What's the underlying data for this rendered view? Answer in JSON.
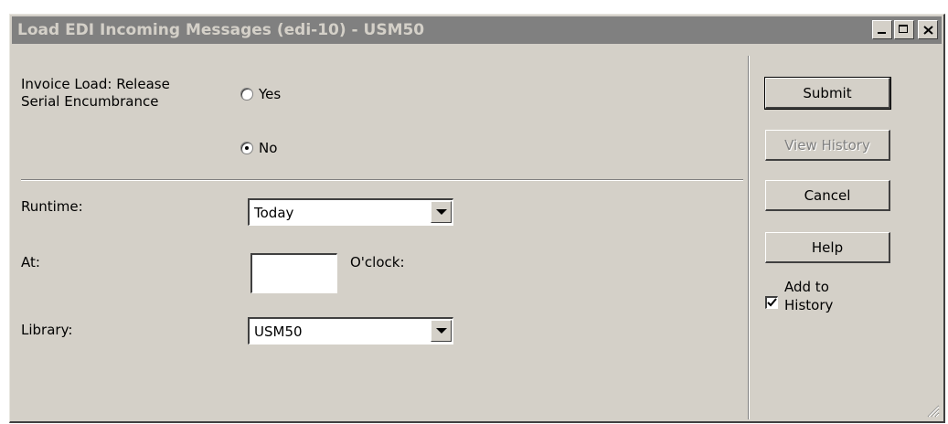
{
  "window": {
    "title": "Load EDI Incoming Messages (edi-10) - USM50"
  },
  "form": {
    "invoice_label_line1": "Invoice Load: Release",
    "invoice_label_line2": "Serial Encumbrance",
    "radio_yes": "Yes",
    "radio_no": "No",
    "selected": "No",
    "runtime_label": "Runtime:",
    "runtime_value": "Today",
    "at_label": "At:",
    "at_value": "",
    "oclock_label": "O'clock:",
    "library_label": "Library:",
    "library_value": "USM50"
  },
  "buttons": {
    "submit": "Submit",
    "view_history": "View History",
    "cancel": "Cancel",
    "help": "Help"
  },
  "add_to_history": {
    "line1": "Add to",
    "line2": "History",
    "checked": true
  },
  "icons": {
    "minimize": "minimize-icon",
    "maximize": "maximize-icon",
    "close": "close-icon",
    "dropdown": "chevron-down-icon",
    "resize": "resize-grip-icon"
  },
  "colors": {
    "window_bg": "#d4d0c8",
    "titlebar_inactive": "#808080",
    "titlebar_text": "#d4d0c8"
  }
}
